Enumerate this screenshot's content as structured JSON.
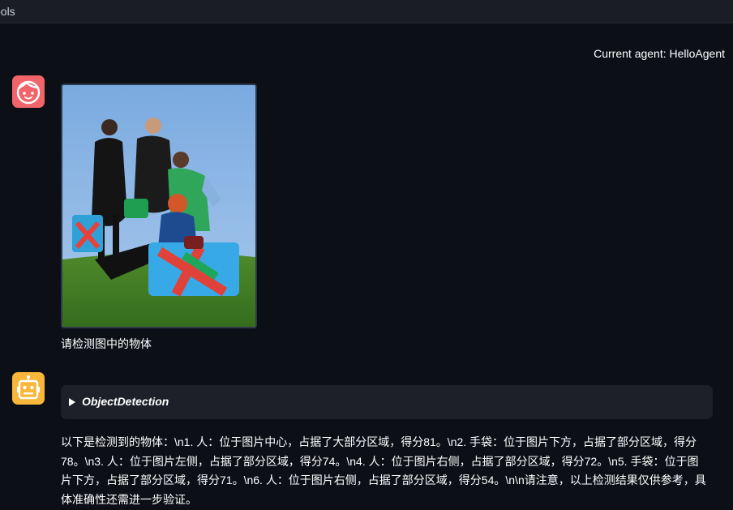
{
  "window": {
    "title": "ools"
  },
  "header": {
    "agent_label": "Current agent: HelloAgent"
  },
  "user_message": {
    "text": "请检测图中的物体"
  },
  "tool_call": {
    "name": "ObjectDetection"
  },
  "assistant_message": {
    "text": "以下是检测到的物体：\\n1. 人：位于图片中心，占据了大部分区域，得分81。\\n2. 手袋：位于图片下方，占据了部分区域，得分78。\\n3. 人：位于图片左侧，占据了部分区域，得分74。\\n4. 人：位于图片右侧，占据了部分区域，得分72。\\n5. 手袋：位于图片下方，占据了部分区域，得分71。\\n6. 人：位于图片右侧，占据了部分区域，得分54。\\n\\n请注意，以上检测结果仅供参考，具体准确性还需进一步验证。"
  },
  "colors": {
    "background": "#0c0f16",
    "user_avatar": "#f0646a",
    "bot_avatar": "#f8b73a",
    "tool_box": "#1d2029"
  },
  "icons": {
    "user_avatar": "face-icon",
    "bot_avatar": "robot-icon",
    "tool_toggle": "triangle-right-icon"
  }
}
